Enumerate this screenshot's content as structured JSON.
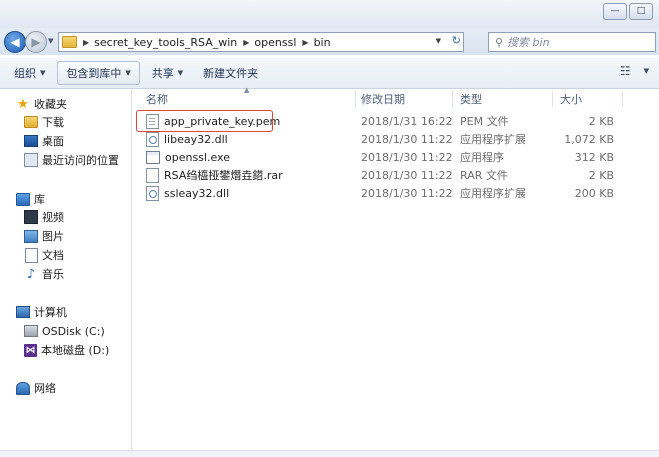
{
  "address": {
    "crumbs": [
      "secret_key_tools_RSA_win",
      "openssl",
      "bin"
    ],
    "search_placeholder": "搜索 bin"
  },
  "window": {
    "minimize": "—",
    "maximize": "□"
  },
  "toolbar": {
    "organize": "组织",
    "include_in_library": "包含到库中",
    "share": "共享",
    "new_folder": "新建文件夹"
  },
  "nav": {
    "favorites": "收藏夹",
    "downloads": "下载",
    "desktop": "桌面",
    "recent": "最近访问的位置",
    "libraries": "库",
    "videos": "视频",
    "pictures": "图片",
    "documents": "文档",
    "music": "音乐",
    "computer": "计算机",
    "disk_c": "OSDisk (C:)",
    "disk_d": "本地磁盘 (D:)",
    "network": "网络"
  },
  "columns": {
    "name": "名称",
    "modified": "修改日期",
    "type": "类型",
    "size": "大小"
  },
  "files": [
    {
      "name": "app_private_key.pem",
      "modified": "2018/1/31 16:22",
      "type": "PEM 文件",
      "size": "2 KB",
      "icon": "pem"
    },
    {
      "name": "libeay32.dll",
      "modified": "2018/1/30 11:22",
      "type": "应用程序扩展",
      "size": "1,072 KB",
      "icon": "dll"
    },
    {
      "name": "openssl.exe",
      "modified": "2018/1/30 11:22",
      "type": "应用程序",
      "size": "312 KB",
      "icon": "exe"
    },
    {
      "name": "RSA绉橀挜鐢熸垚鍣.rar",
      "modified": "2018/1/30 11:22",
      "type": "RAR 文件",
      "size": "2 KB",
      "icon": "rar"
    },
    {
      "name": "ssleay32.dll",
      "modified": "2018/1/30 11:22",
      "type": "应用程序扩展",
      "size": "200 KB",
      "icon": "dll"
    }
  ],
  "colors": {
    "highlight": "#e0443a",
    "nav_back": "#1b5bb0"
  }
}
